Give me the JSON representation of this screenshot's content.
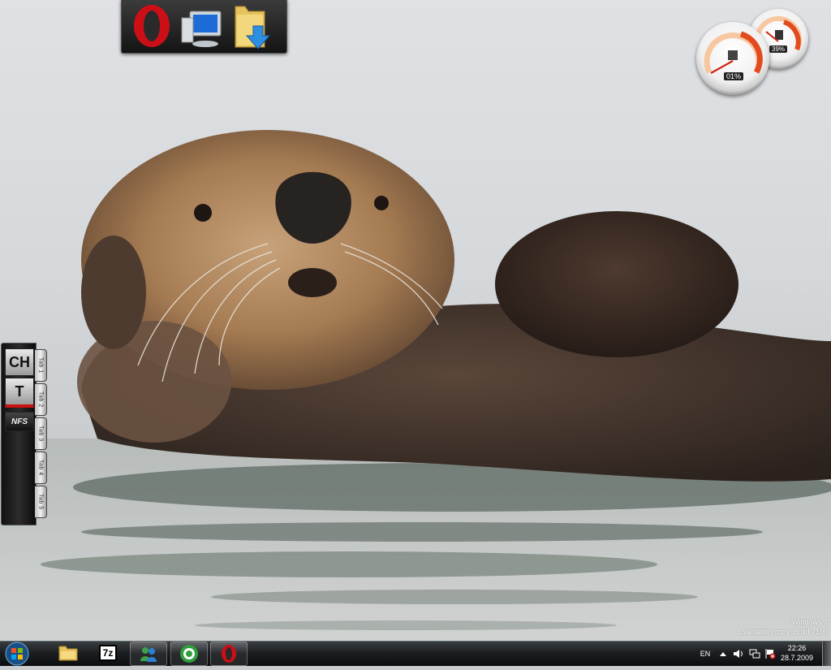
{
  "wallpaper": {
    "subject": "sea otter floating in water"
  },
  "launcher": {
    "items": [
      {
        "name": "Opera",
        "icon": "opera-icon"
      },
      {
        "name": "Computer",
        "icon": "computer-icon"
      },
      {
        "name": "Downloads",
        "icon": "downloads-folder-icon"
      }
    ]
  },
  "gadgets": {
    "cpu_meter": {
      "cpu_label": "01%",
      "cpu_value": 1,
      "ram_label": "39%",
      "ram_value": 39
    }
  },
  "side_tabs": {
    "logos": [
      "CH",
      "T",
      "NFS"
    ],
    "tabs": [
      "Tab 1",
      "Tab 2",
      "Tab 3",
      "Tab 4",
      "Tab 5"
    ]
  },
  "watermark": {
    "line1": "Windows 7",
    "line2": "Evaluation copy. Build 7100"
  },
  "taskbar": {
    "start_icon": "windows-start-icon",
    "pinned": [
      {
        "name": "Windows Explorer",
        "icon": "explorer-folder-icon",
        "open": false
      },
      {
        "name": "7-Zip",
        "icon": "7zip-icon",
        "label": "7z",
        "open": false
      },
      {
        "name": "Messenger",
        "icon": "messenger-icon",
        "open": true
      },
      {
        "name": "Media player",
        "icon": "green-circle-icon",
        "open": true
      },
      {
        "name": "Opera",
        "icon": "opera-icon",
        "open": true
      }
    ],
    "tray": {
      "language": "EN",
      "icons": [
        "show-hidden-icons-arrow",
        "volume-icon",
        "network-icon",
        "action-center-flag-icon"
      ],
      "time": "22:26",
      "date": "28.7.2009"
    }
  },
  "colors": {
    "opera_red": "#cc0f16",
    "taskbar_dark": "#0b0d0f"
  }
}
